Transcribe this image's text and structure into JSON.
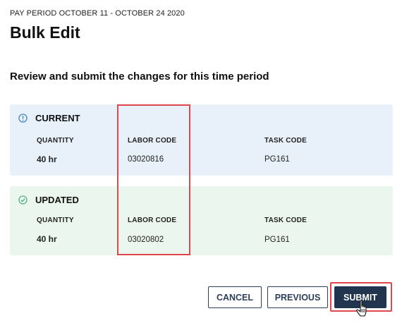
{
  "header": {
    "pay_period": "PAY PERIOD OCTOBER 11 - OCTOBER 24 2020",
    "title": "Bulk Edit",
    "subtitle": "Review and submit the changes for this time period"
  },
  "current": {
    "label": "CURRENT",
    "icon": "info-circle-icon",
    "quantity_label": "QUANTITY",
    "quantity_value": "40 hr",
    "labor_code_label": "LABOR CODE",
    "labor_code_value": "03020816",
    "task_code_label": "TASK CODE",
    "task_code_value": "PG161"
  },
  "updated": {
    "label": "UPDATED",
    "icon": "check-circle-icon",
    "quantity_label": "QUANTITY",
    "quantity_value": "40 hr",
    "labor_code_label": "LABOR CODE",
    "labor_code_value": "03020802",
    "task_code_label": "TASK CODE",
    "task_code_value": "PG161"
  },
  "actions": {
    "cancel_label": "CANCEL",
    "previous_label": "PREVIOUS",
    "submit_label": "SUBMIT"
  },
  "colors": {
    "current_bg": "#e8f1fa",
    "updated_bg": "#ebf6ef",
    "primary": "#22354f",
    "highlight": "#e0474c",
    "info_icon": "#3b7fc4",
    "check_icon": "#4caf7a"
  }
}
